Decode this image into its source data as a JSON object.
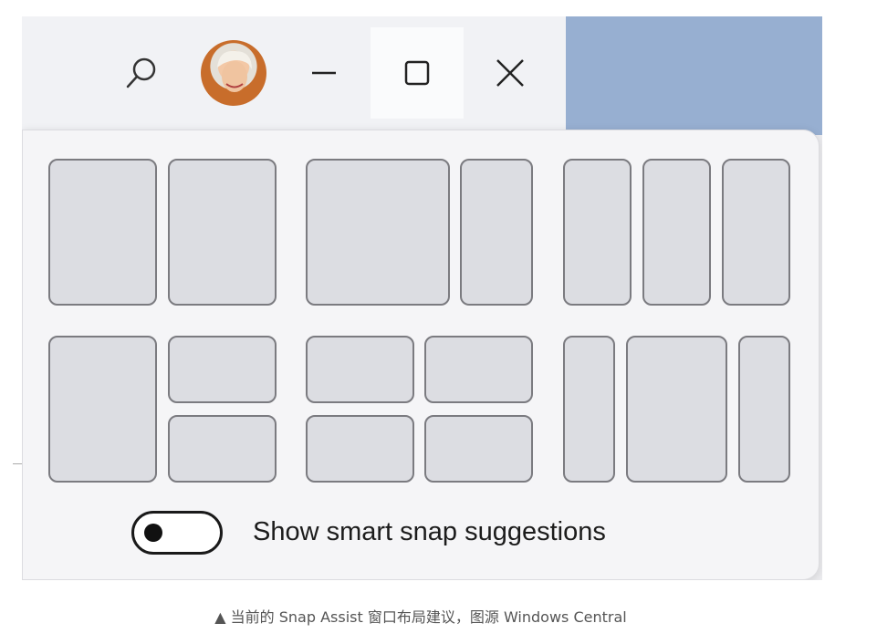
{
  "window": {
    "buttons": [
      {
        "name": "search",
        "icon": "search-icon"
      },
      {
        "name": "account",
        "icon": "avatar"
      },
      {
        "name": "minimize",
        "icon": "minimize-icon"
      },
      {
        "name": "maximize",
        "icon": "maximize-icon",
        "state": "hovered"
      },
      {
        "name": "close",
        "icon": "close-icon"
      }
    ]
  },
  "snap_layouts": {
    "layouts": [
      {
        "name": "two-equal-columns",
        "zones": 2
      },
      {
        "name": "wide-left-narrow-right",
        "zones": 2
      },
      {
        "name": "three-equal-columns",
        "zones": 3
      },
      {
        "name": "left-column-right-stacked",
        "zones": 3
      },
      {
        "name": "four-quadrants",
        "zones": 4
      },
      {
        "name": "narrow-wide-narrow",
        "zones": 3
      }
    ],
    "toggle": {
      "label": "Show smart snap suggestions",
      "state": "off"
    }
  },
  "caption": "▲ 当前的 Snap Assist 窗口布局建议，图源 Windows Central",
  "colors": {
    "accent_blue": "#97afd1",
    "zone_fill": "#dcdde2",
    "zone_border": "#7b7b80"
  }
}
